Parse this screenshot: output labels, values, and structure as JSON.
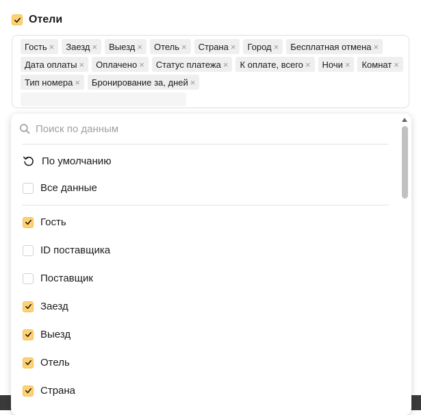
{
  "section": {
    "title": "Отели",
    "checked": true
  },
  "tags": [
    "Гость",
    "Заезд",
    "Выезд",
    "Отель",
    "Страна",
    "Город",
    "Бесплатная отмена",
    "Дата оплаты",
    "Оплачено",
    "Статус платежа",
    "К оплате, всего",
    "Ночи",
    "Комнат",
    "Тип номера",
    "Бронирование за, дней"
  ],
  "dropdown": {
    "search_placeholder": "Поиск по данным",
    "reset_label": "По умолчанию",
    "all_label": "Все данные",
    "options": [
      {
        "label": "Гость",
        "checked": true
      },
      {
        "label": "ID поставщика",
        "checked": false
      },
      {
        "label": "Поставщик",
        "checked": false
      },
      {
        "label": "Заезд",
        "checked": true
      },
      {
        "label": "Выезд",
        "checked": true
      },
      {
        "label": "Отель",
        "checked": true
      },
      {
        "label": "Страна",
        "checked": true
      }
    ]
  },
  "colors": {
    "accent": "#ffd173",
    "tag_bg": "#efefef"
  }
}
